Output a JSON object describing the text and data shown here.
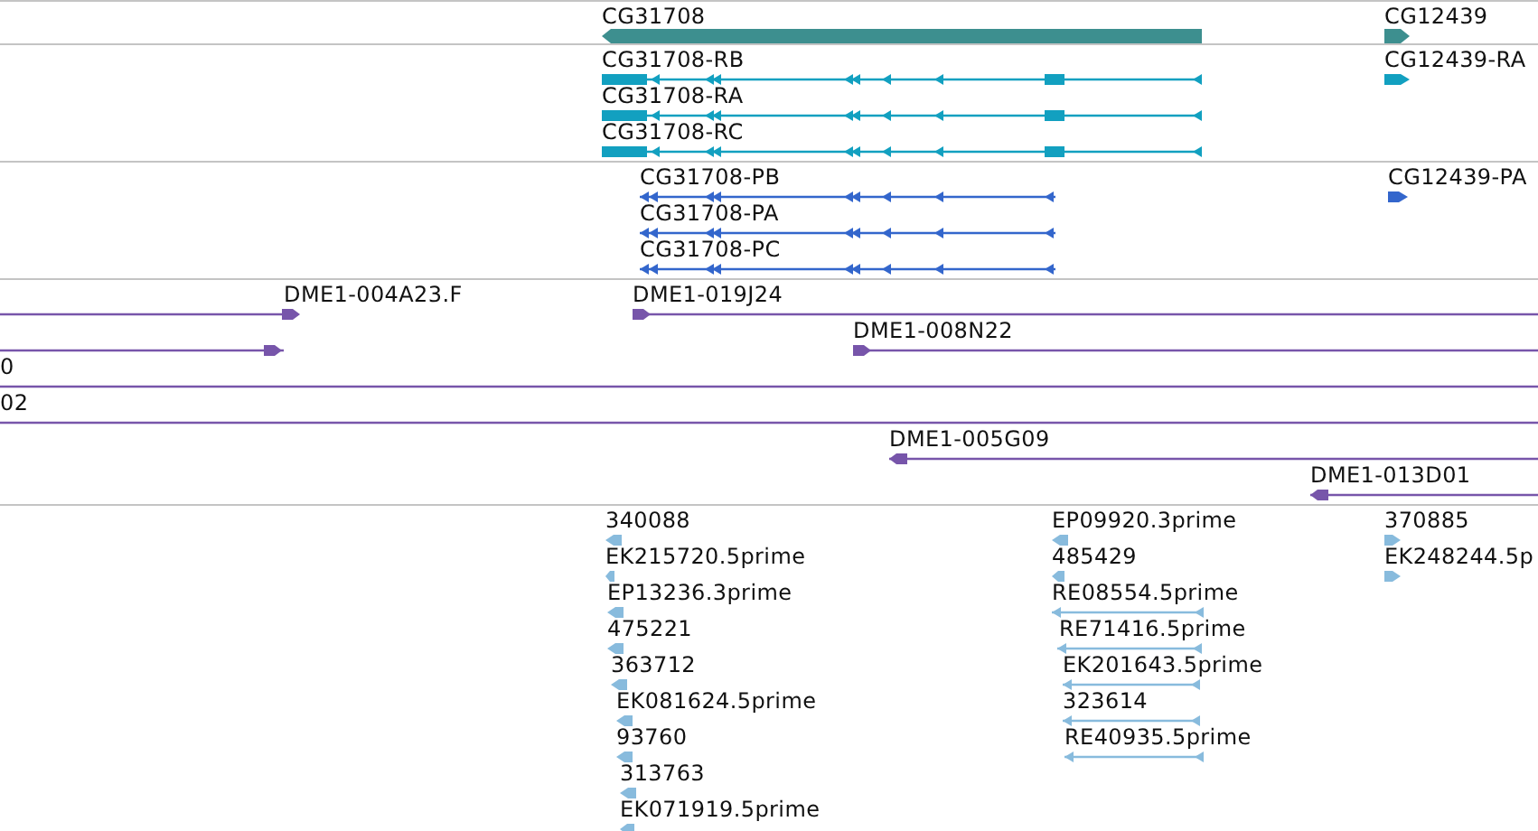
{
  "tracks": [
    {
      "kind": "gene",
      "features": [
        {
          "label": "CG31708",
          "reverse": true
        },
        {
          "label": "CG12439",
          "reverse": false
        }
      ]
    },
    {
      "kind": "transcript",
      "features": [
        {
          "label": "CG31708-RB",
          "reverse": true
        },
        {
          "label": "CG31708-RA",
          "reverse": true
        },
        {
          "label": "CG31708-RC",
          "reverse": true
        },
        {
          "label": "CG12439-RA",
          "reverse": false
        }
      ]
    },
    {
      "kind": "protein",
      "features": [
        {
          "label": "CG31708-PB",
          "reverse": true
        },
        {
          "label": "CG31708-PA",
          "reverse": true
        },
        {
          "label": "CG31708-PC",
          "reverse": true
        },
        {
          "label": "CG12439-PA",
          "reverse": false
        }
      ]
    },
    {
      "kind": "clone",
      "features": [
        {
          "label": "DME1-004A23.F",
          "reverse": false
        },
        {
          "label": "DME1-019J24",
          "reverse": false
        },
        {
          "reverse": false
        },
        {
          "label": "DME1-008N22",
          "reverse": false
        },
        {
          "label": "0"
        },
        {
          "label": "02"
        },
        {
          "label": "DME1-005G09",
          "reverse": true
        },
        {
          "label": "DME1-013D01",
          "reverse": true
        }
      ]
    },
    {
      "kind": "est",
      "features": [
        {
          "label": "340088",
          "reverse": true
        },
        {
          "label": "EK215720.5prime",
          "reverse": true
        },
        {
          "label": "EP13236.3prime",
          "reverse": true
        },
        {
          "label": "475221",
          "reverse": true
        },
        {
          "label": "363712",
          "reverse": true
        },
        {
          "label": "EK081624.5prime",
          "reverse": true
        },
        {
          "label": "93760",
          "reverse": true
        },
        {
          "label": "313763",
          "reverse": true
        },
        {
          "label": "EK071919.5prime",
          "reverse": true
        },
        {
          "label": "EP09920.3prime",
          "reverse": true
        },
        {
          "label": "485429",
          "reverse": true
        },
        {
          "label": "RE08554.5prime",
          "reverse": true
        },
        {
          "label": "RE71416.5prime",
          "reverse": true
        },
        {
          "label": "EK201643.5prime",
          "reverse": true
        },
        {
          "label": "323614",
          "reverse": true
        },
        {
          "label": "RE40935.5prime",
          "reverse": true
        },
        {
          "label": "370885",
          "reverse": false
        },
        {
          "label": "EK248244.5p",
          "reverse": false
        }
      ]
    }
  ]
}
